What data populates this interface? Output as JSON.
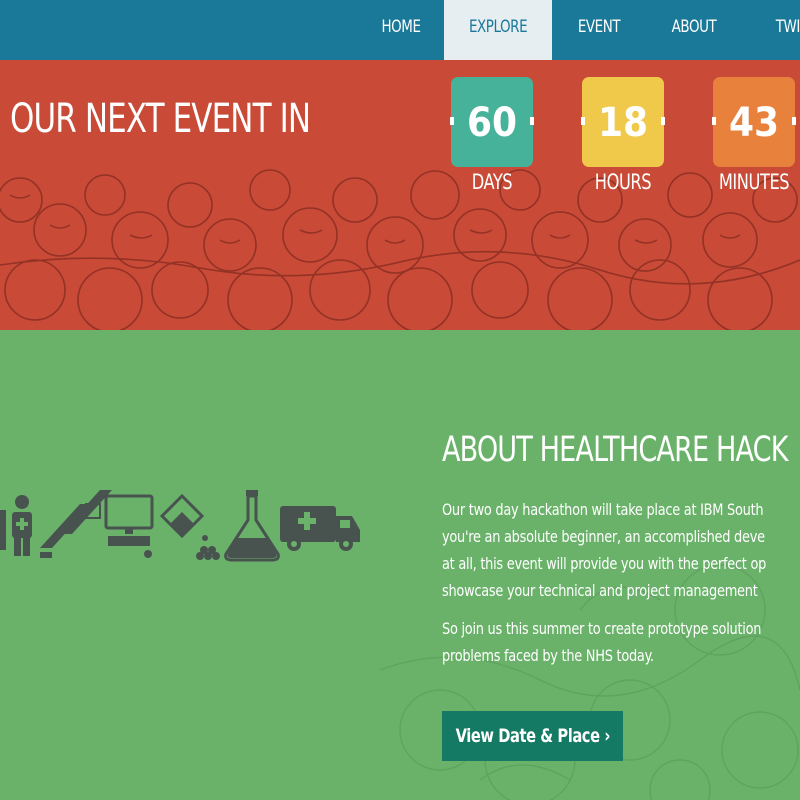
{
  "nav": {
    "items": [
      {
        "label": "HOME",
        "active": false
      },
      {
        "label": "EXPLORE",
        "active": true
      },
      {
        "label": "EVENT",
        "active": false
      },
      {
        "label": "ABOUT",
        "active": false
      },
      {
        "label": "TWITTER",
        "active": false
      }
    ]
  },
  "hero": {
    "title": "OUR NEXT EVENT IN",
    "countdown": [
      {
        "value": "60",
        "label": "DAYS",
        "color": "#46b29a"
      },
      {
        "value": "18",
        "label": "HOURS",
        "color": "#f0c94a"
      },
      {
        "value": "43",
        "label": "MINUTES",
        "color": "#e8813c"
      }
    ]
  },
  "about": {
    "title": "ABOUT HEALTHCARE HACK",
    "paragraph1": [
      "Our two day hackathon will take place at IBM South",
      "you're an absolute beginner, an accomplished deve",
      "at all, this event will provide you with the perfect op",
      "showcase your technical and project management"
    ],
    "paragraph2": [
      "So join us this summer to create prototype solution",
      "problems faced by the NHS today."
    ],
    "cta_label": "View Date & Place ›",
    "icons": [
      "person-medical-icon",
      "dna-helix-icon",
      "computer-icon",
      "pouring-beaker-icon",
      "flask-icon",
      "ambulance-icon"
    ]
  },
  "colors": {
    "nav_bg": "#1a7898",
    "hero_bg": "#c84a37",
    "about_bg": "#6ab26a",
    "icon": "#48534f",
    "cta_bg": "#157a64"
  }
}
